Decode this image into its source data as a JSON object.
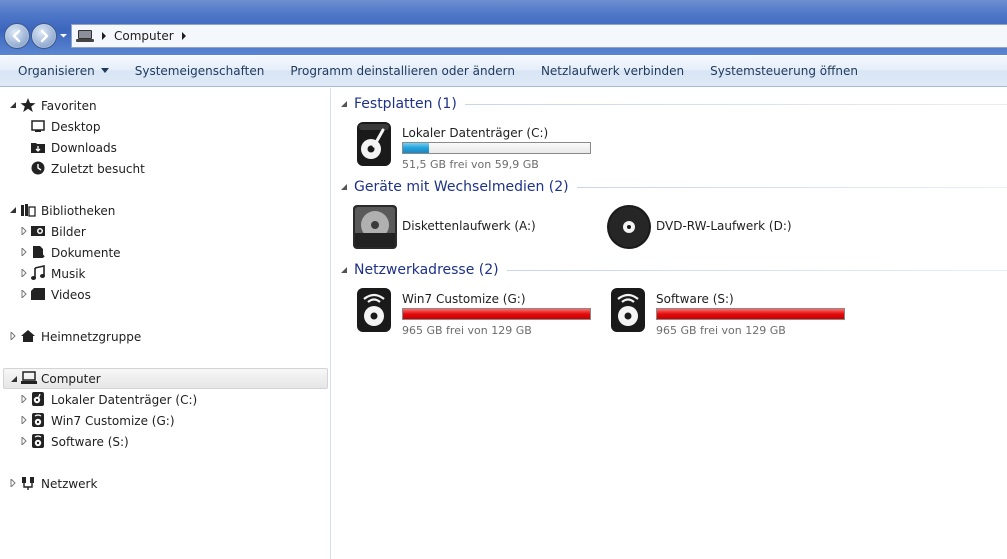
{
  "addressbar": {
    "path": "Computer"
  },
  "commandbar": {
    "organize": "Organisieren",
    "system_properties": "Systemeigenschaften",
    "uninstall": "Programm deinstallieren oder ändern",
    "map_drive": "Netzlaufwerk verbinden",
    "control_panel": "Systemsteuerung öffnen"
  },
  "navpane": {
    "favorites": {
      "label": "Favoriten",
      "items": [
        "Desktop",
        "Downloads",
        "Zuletzt besucht"
      ]
    },
    "libraries": {
      "label": "Bibliotheken",
      "items": [
        "Bilder",
        "Dokumente",
        "Musik",
        "Videos"
      ]
    },
    "homegroup": {
      "label": "Heimnetzgruppe"
    },
    "computer": {
      "label": "Computer",
      "items": [
        "Lokaler Datenträger (C:)",
        "Win7 Customize (G:)",
        "Software (S:)"
      ]
    },
    "network": {
      "label": "Netzwerk"
    }
  },
  "content": {
    "groups": [
      {
        "title": "Festplatten (1)",
        "drives": [
          {
            "name": "Lokaler Datenträger (C:)",
            "free": "51,5 GB frei von 59,9 GB",
            "used_fraction": 0.14,
            "bar_color": "#26a0da"
          }
        ]
      },
      {
        "title": "Geräte mit Wechselmedien (2)",
        "drives": [
          {
            "name": "Diskettenlaufwerk (A:)"
          },
          {
            "name": "DVD-RW-Laufwerk (D:)"
          }
        ]
      },
      {
        "title": "Netzwerkadresse (2)",
        "drives": [
          {
            "name": "Win7 Customize (G:)",
            "free": "965 GB frei von 129 GB",
            "used_fraction": 1.0,
            "bar_color": "#e20c0c"
          },
          {
            "name": "Software (S:)",
            "free": "965 GB frei von 129 GB",
            "used_fraction": 1.0,
            "bar_color": "#e20c0c"
          }
        ]
      }
    ]
  }
}
